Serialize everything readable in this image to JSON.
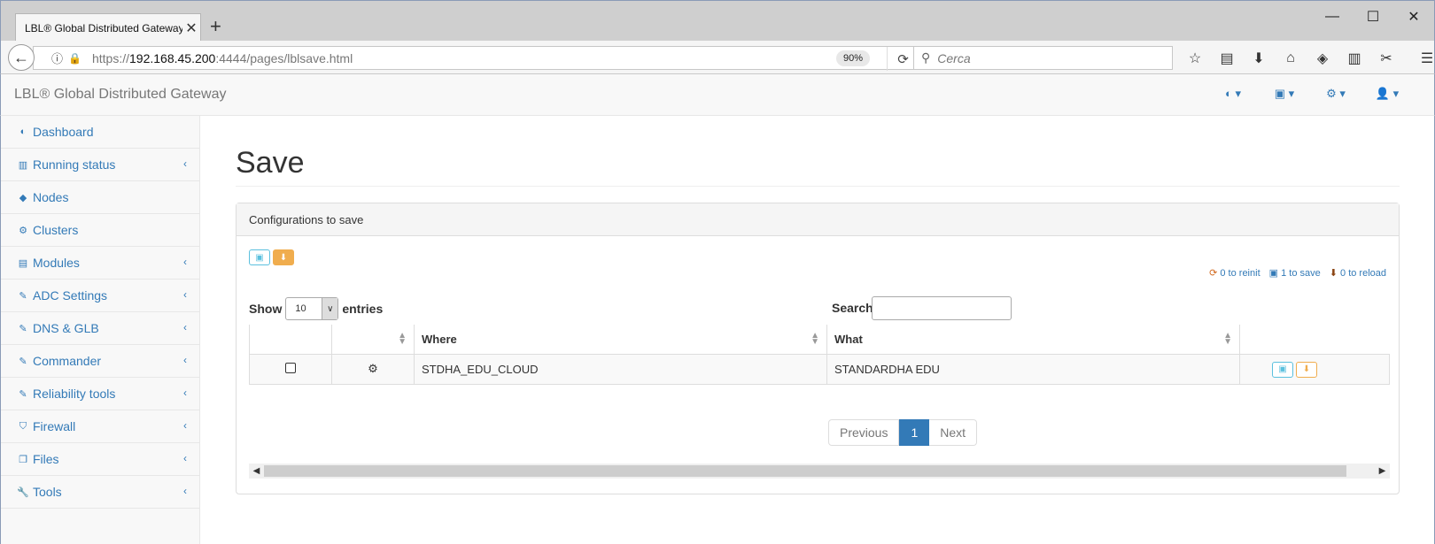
{
  "browser": {
    "tab_title": "LBL® Global Distributed Gateway",
    "url_scheme": "https://",
    "url_host": "192.168.45.200",
    "url_path": ":4444/pages/lblsave.html",
    "zoom": "90%",
    "search_placeholder": "Cerca"
  },
  "header": {
    "brand": "LBL® Global Distributed Gateway",
    "menus": [
      "dashboard-icon",
      "save-icon",
      "gear-icon",
      "user-icon"
    ]
  },
  "sidebar": {
    "items": [
      {
        "label": "Dashboard",
        "icon": "dashboard-icon",
        "has_arrow": false
      },
      {
        "label": "Running status",
        "icon": "bar-chart-icon",
        "has_arrow": true
      },
      {
        "label": "Nodes",
        "icon": "cube-icon",
        "has_arrow": false
      },
      {
        "label": "Clusters",
        "icon": "gears-icon",
        "has_arrow": false
      },
      {
        "label": "Modules",
        "icon": "list-icon",
        "has_arrow": true
      },
      {
        "label": "ADC Settings",
        "icon": "edit-icon",
        "has_arrow": true
      },
      {
        "label": "DNS & GLB",
        "icon": "edit-icon",
        "has_arrow": true
      },
      {
        "label": "Commander",
        "icon": "edit-icon",
        "has_arrow": true
      },
      {
        "label": "Reliability tools",
        "icon": "edit-icon",
        "has_arrow": true
      },
      {
        "label": "Firewall",
        "icon": "shield-icon",
        "has_arrow": true
      },
      {
        "label": "Files",
        "icon": "files-icon",
        "has_arrow": true
      },
      {
        "label": "Tools",
        "icon": "wrench-icon",
        "has_arrow": true
      }
    ]
  },
  "page": {
    "title": "Save",
    "panel_heading": "Configurations to save",
    "counters": {
      "reinit": "0 to reinit",
      "save": "1 to save",
      "reload": "0 to reload"
    },
    "show_label": "Show",
    "entries_value": "10",
    "entries_label": "entries",
    "search_label": "Search:",
    "columns": [
      "",
      "",
      "Where",
      "What",
      ""
    ],
    "rows": [
      {
        "where": "STDHA_EDU_CLOUD",
        "what": "STANDARDHA EDU"
      }
    ],
    "pager": {
      "previous": "Previous",
      "current": "1",
      "next": "Next"
    }
  }
}
